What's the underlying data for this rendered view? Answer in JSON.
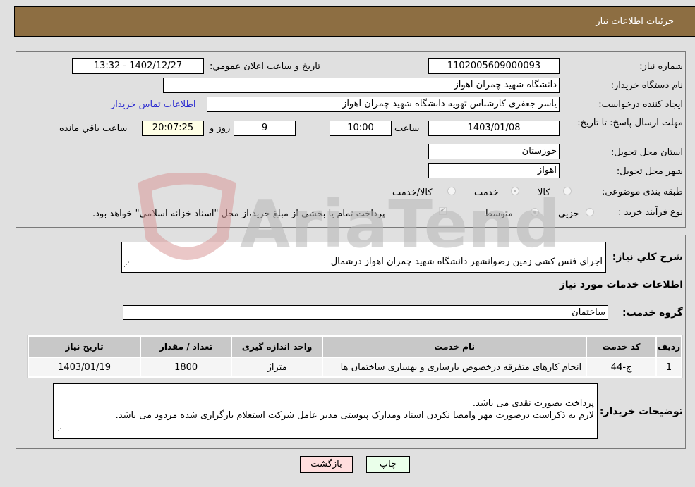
{
  "header": {
    "title": "جزئیات اطلاعات نیاز"
  },
  "details": {
    "need_number_label": "شماره نیاز:",
    "need_number": "1102005609000093",
    "announce_label": "تاریخ و ساعت اعلان عمومي:",
    "announce_value": "1402/12/27 - 13:32",
    "buyer_org_label": "نام دستگاه خریدار:",
    "buyer_org": "دانشگاه شهید چمران اهواز",
    "creator_label": "ایجاد کننده درخواست:",
    "creator": "یاسر جعفری کارشناس تهویه دانشگاه شهید چمران اهواز",
    "contact_link": "اطلاعات تماس خریدار",
    "deadline_label": "مهلت ارسال پاسخ: تا تاریخ:",
    "deadline_date": "1403/01/08",
    "time_label": "ساعت",
    "deadline_time": "10:00",
    "days_value": "9",
    "days_label": "روز و",
    "remaining_time": "20:07:25",
    "remaining_label": "ساعت باقي مانده",
    "province_label": "استان محل تحویل:",
    "province": "خوزستان",
    "city_label": "شهر محل تحویل:",
    "city": "اهواز",
    "category_label": "طبقه بندی موضوعی:",
    "category_options": [
      {
        "label": "کالا",
        "selected": false
      },
      {
        "label": "خدمت",
        "selected": true
      },
      {
        "label": "کالا/خدمت",
        "selected": false
      }
    ],
    "purchase_type_label": "نوع فرآیند خرید :",
    "purchase_type_options": [
      {
        "label": "جزيي",
        "selected": false
      },
      {
        "label": "متوسط",
        "selected": true
      }
    ],
    "treasury_checkbox_label": "پرداخت تمام یا بخشی از مبلغ خرید،از محل \"اسناد خزانه اسلامی\" خواهد بود.",
    "treasury_checked": true
  },
  "description": {
    "label": "شرح كلي نياز:",
    "value": "اجرای فنس کشی زمین رضوانشهر دانشگاه شهید چمران اهواز درشمال"
  },
  "services": {
    "section_title": "اطلاعات خدمات مورد نیاز",
    "group_label": "گروه خدمت:",
    "group_value": "ساختمان",
    "columns": [
      "ردیف",
      "کد خدمت",
      "نام خدمت",
      "واحد اندازه گیری",
      "تعداد / مقدار",
      "تاریخ نیاز"
    ],
    "rows": [
      [
        "1",
        "ج-44",
        "انجام کارهای متفرقه درخصوص بازسازی و بهسازی ساختمان ها",
        "متراژ",
        "1800",
        "1403/01/19"
      ]
    ]
  },
  "buyer_notes": {
    "label": "توضیحات خریدار:",
    "value": "پرداخت بصورت نقدی  می باشد.\nلازم به ذکراست درصورت مهر وامضا نکردن اسناد ومدارک پیوستی مدیر عامل شرکت استعلام بارگزاری شده مردود می باشد."
  },
  "buttons": {
    "print": "چاپ",
    "back": "بازگشت"
  },
  "watermark": {
    "text": "AriaTender.neT"
  }
}
